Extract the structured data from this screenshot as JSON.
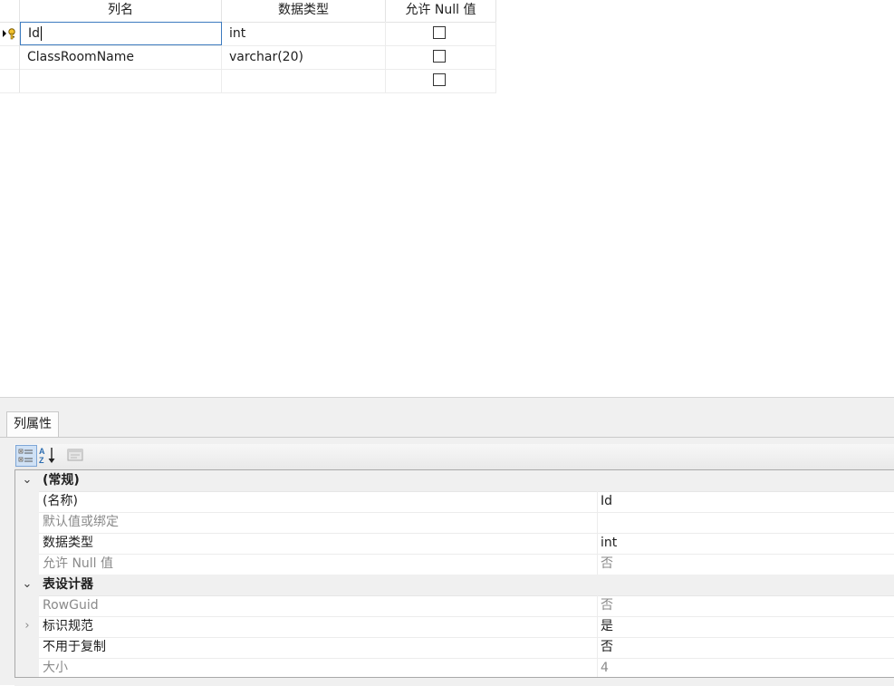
{
  "grid": {
    "headers": [
      "列名",
      "数据类型",
      "允许 Null 值"
    ],
    "rows": [
      {
        "name": "Id",
        "type": "int",
        "allow_null": false
      },
      {
        "name": "ClassRoomName",
        "type": "varchar(20)",
        "allow_null": false
      },
      {
        "name": "",
        "type": "",
        "allow_null": false
      }
    ]
  },
  "panel": {
    "tab_label": "列属性",
    "toolbar": {
      "categorized_icon": "categorized-icon",
      "alphabetical_icon": "sort-az-icon",
      "property_pages_icon": "property-pages-icon"
    },
    "categories": [
      {
        "label": "(常规)",
        "properties": [
          {
            "name": "(名称)",
            "value": "Id",
            "dim": false
          },
          {
            "name": "默认值或绑定",
            "value": "",
            "dim": true
          },
          {
            "name": "数据类型",
            "value": "int",
            "dim": false
          },
          {
            "name": "允许 Null 值",
            "value": "否",
            "dim": true
          }
        ]
      },
      {
        "label": "表设计器",
        "properties": [
          {
            "name": "RowGuid",
            "value": "否",
            "dim": true
          },
          {
            "name": "标识规范",
            "value": "是",
            "dim": false,
            "expandable": true
          },
          {
            "name": "不用于复制",
            "value": "否",
            "dim": false
          },
          {
            "name": "大小",
            "value": "4",
            "dim": true
          }
        ]
      }
    ]
  }
}
